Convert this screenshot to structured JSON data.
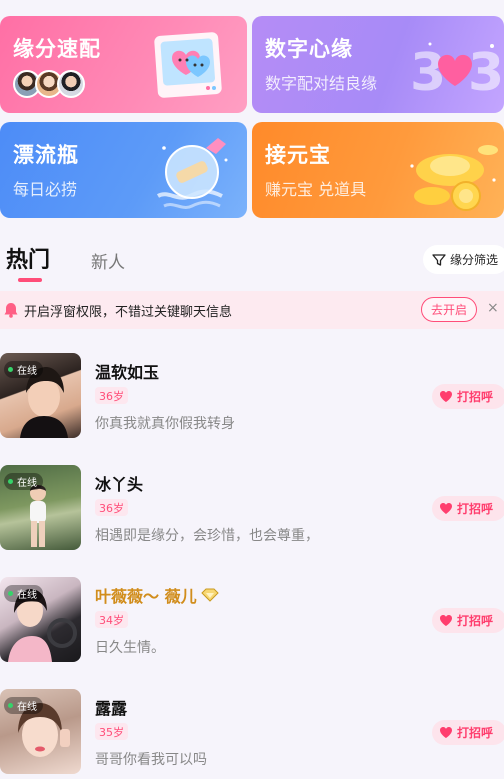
{
  "cards": {
    "match": {
      "title": "缘分速配"
    },
    "numbers": {
      "title": "数字心缘",
      "subtitle": "数字配对结良缘"
    },
    "bottle": {
      "title": "漂流瓶",
      "subtitle": "每日必捞"
    },
    "ingot": {
      "title": "接元宝",
      "subtitle": "赚元宝 兑道具"
    }
  },
  "tabs": {
    "hot": "热门",
    "new": "新人"
  },
  "filter": {
    "label": "缘分筛选"
  },
  "notice": {
    "text": "开启浮窗权限，不错过关键聊天信息",
    "open_label": "去开启",
    "close_label": "×"
  },
  "users": [
    {
      "name": "温软如玉",
      "age": "36岁",
      "bio": "你真我就真你假我转身",
      "online": "在线",
      "greet": "打招呼",
      "name_style": "normal"
    },
    {
      "name": "冰丫头",
      "age": "36岁",
      "bio": "相遇即是缘分，会珍惜，也会尊重，",
      "online": "在线",
      "greet": "打招呼",
      "name_style": "normal"
    },
    {
      "name": "叶薇薇～ 薇儿",
      "age": "34岁",
      "bio": "日久生情。",
      "online": "在线",
      "greet": "打招呼",
      "name_style": "gold"
    },
    {
      "name": "露露",
      "age": "35岁",
      "bio": "哥哥你看我可以吗",
      "online": "在线",
      "greet": "打招呼",
      "name_style": "normal"
    }
  ],
  "colors": {
    "accent": "#ff4d79",
    "gold_name": "#d18d1c"
  }
}
